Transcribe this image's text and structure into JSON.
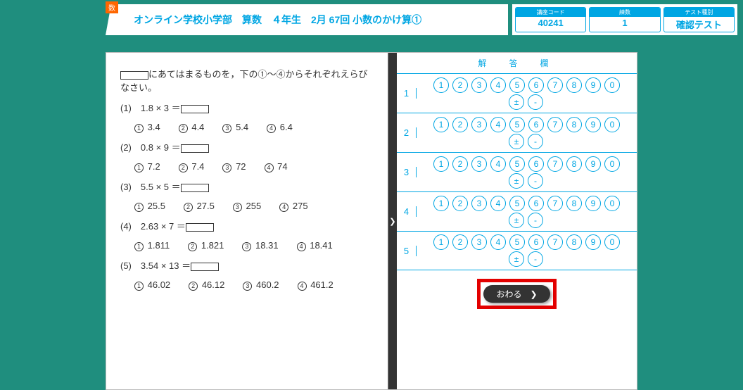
{
  "subject_badge": "数",
  "title": "オンライン学校小学部　算数　４年生　2月 67回 小数のかけ算①",
  "info": {
    "code_label": "講座コード",
    "code_value": "40241",
    "num_label": "練数",
    "num_value": "1",
    "type_label": "テスト種別",
    "type_value": "確認テスト"
  },
  "answer_title": "解　答　欄",
  "question": {
    "instruction_suffix": "にあてはまるものを，下の①〜④からそれぞれえらびなさい。",
    "items": [
      {
        "idx": "(1)",
        "expr": "1.8 × 3 ＝",
        "opts": [
          "3.4",
          "4.4",
          "5.4",
          "6.4"
        ]
      },
      {
        "idx": "(2)",
        "expr": "0.8 × 9 ＝",
        "opts": [
          "7.2",
          "7.4",
          "72",
          "74"
        ]
      },
      {
        "idx": "(3)",
        "expr": "5.5 × 5 ＝",
        "opts": [
          "25.5",
          "27.5",
          "255",
          "275"
        ]
      },
      {
        "idx": "(4)",
        "expr": "2.63 × 7 ＝",
        "opts": [
          "1.811",
          "1.821",
          "18.31",
          "18.41"
        ]
      },
      {
        "idx": "(5)",
        "expr": "3.54 × 13 ＝",
        "opts": [
          "46.02",
          "46.12",
          "460.2",
          "461.2"
        ]
      }
    ]
  },
  "bubbles_top": [
    "1",
    "2",
    "3",
    "4",
    "5",
    "6",
    "7",
    "8",
    "9",
    "0"
  ],
  "bubbles_bot": [
    "±",
    "-"
  ],
  "rows": [
    "1",
    "2",
    "3",
    "4",
    "5"
  ],
  "end_label": "おわる"
}
